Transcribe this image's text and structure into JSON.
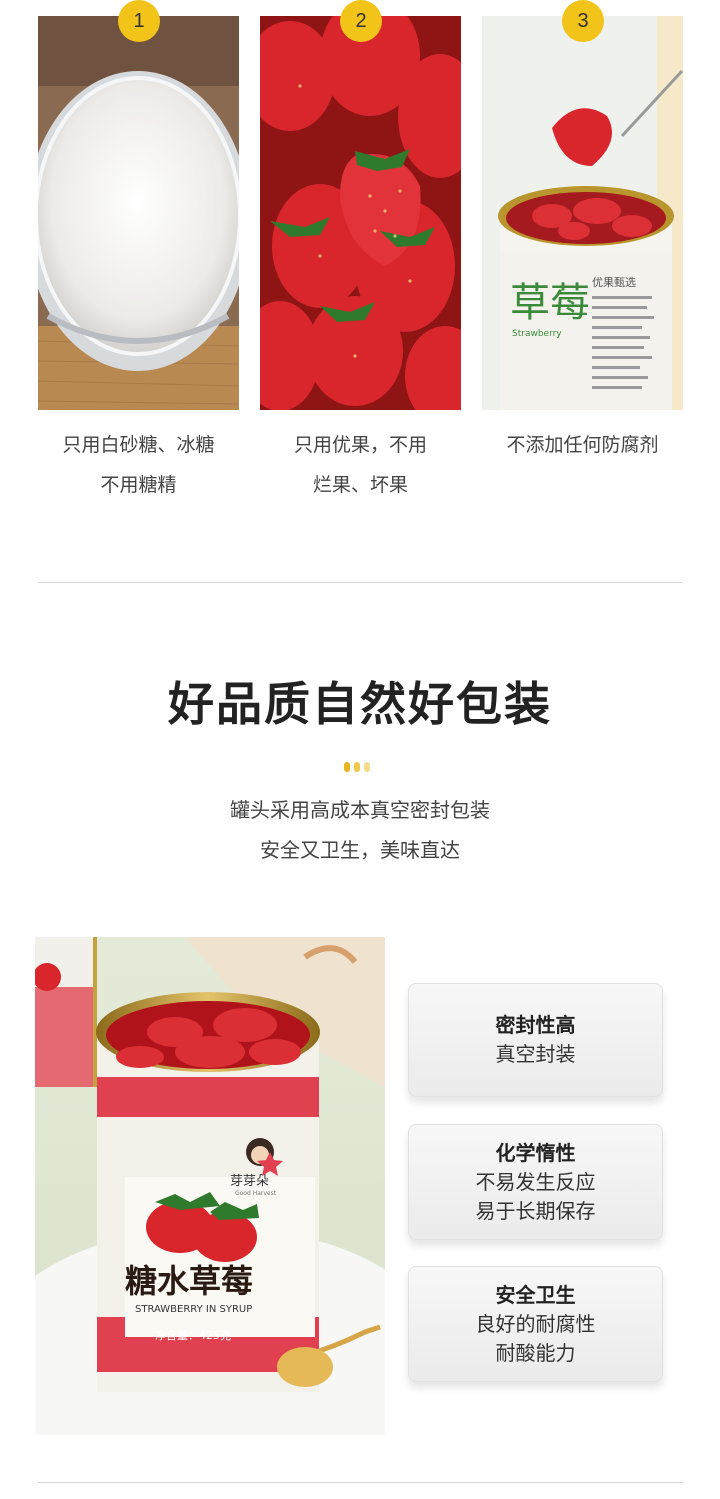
{
  "features": [
    {
      "number": "1",
      "line1": "只用白砂糖、冰糖",
      "line2": "不用糖精"
    },
    {
      "number": "2",
      "line1": "只用优果，不用",
      "line2": "烂果、坏果"
    },
    {
      "number": "3",
      "line1": "不添加任何防腐剂",
      "line2": ""
    }
  ],
  "section": {
    "headline": "好品质自然好包装",
    "subtitle_line1": "罐头采用高成本真空密封包装",
    "subtitle_line2": "安全又卫生，美味直达"
  },
  "can": {
    "side_word": "草莓",
    "side_en": "Strawberry",
    "side_small": "优果甄选",
    "main_title": "糖水草莓",
    "main_en": "STRAWBERRY IN SYRUP",
    "net_weight": "净含量：425克",
    "brand": "芽芽朵",
    "brand_sub": "Good Harvest"
  },
  "cards": [
    {
      "title": "密封性高",
      "line1": "真空封装",
      "line2": ""
    },
    {
      "title": "化学惰性",
      "line1": "不易发生反应",
      "line2": "易于长期保存"
    },
    {
      "title": "安全卫生",
      "line1": "良好的耐腐性",
      "line2": "耐酸能力"
    }
  ],
  "colors": {
    "badge": "#f2c318",
    "accent_red": "#e04050",
    "strawberry": "#d8262c"
  }
}
